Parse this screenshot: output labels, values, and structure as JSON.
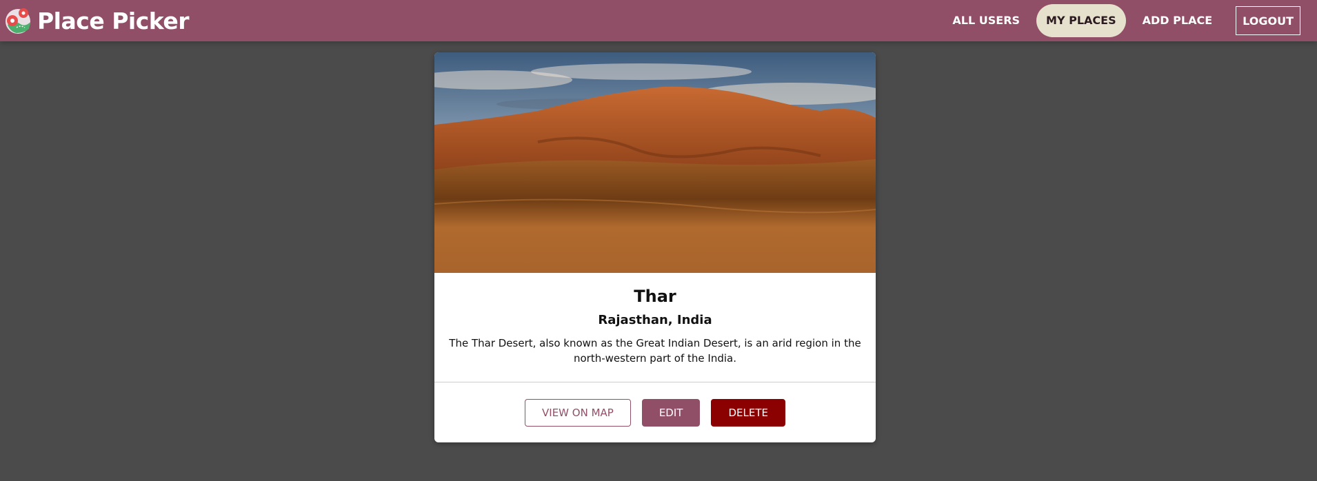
{
  "header": {
    "title": "Place Picker",
    "logo_icon": "map-pin-logo-icon",
    "nav": {
      "all_users": "ALL USERS",
      "my_places": "MY PLACES",
      "add_place": "ADD PLACE",
      "logout": "LOGOUT"
    },
    "active_item": "MY PLACES"
  },
  "place": {
    "image_subject": "desert dunes under cloudy sky",
    "title": "Thar",
    "address": "Rajasthan, India",
    "description": "The Thar Desert, also known as the Great Indian Desert, is an arid region in the north-western part of the India.",
    "actions": {
      "view_on_map": "VIEW ON MAP",
      "edit": "EDIT",
      "delete": "DELETE"
    }
  },
  "colors": {
    "header_bg": "#914f67",
    "page_bg": "#4b4b4b",
    "active_nav_bg": "#e6e1cc",
    "primary": "#914f67",
    "danger": "#8b0000"
  }
}
